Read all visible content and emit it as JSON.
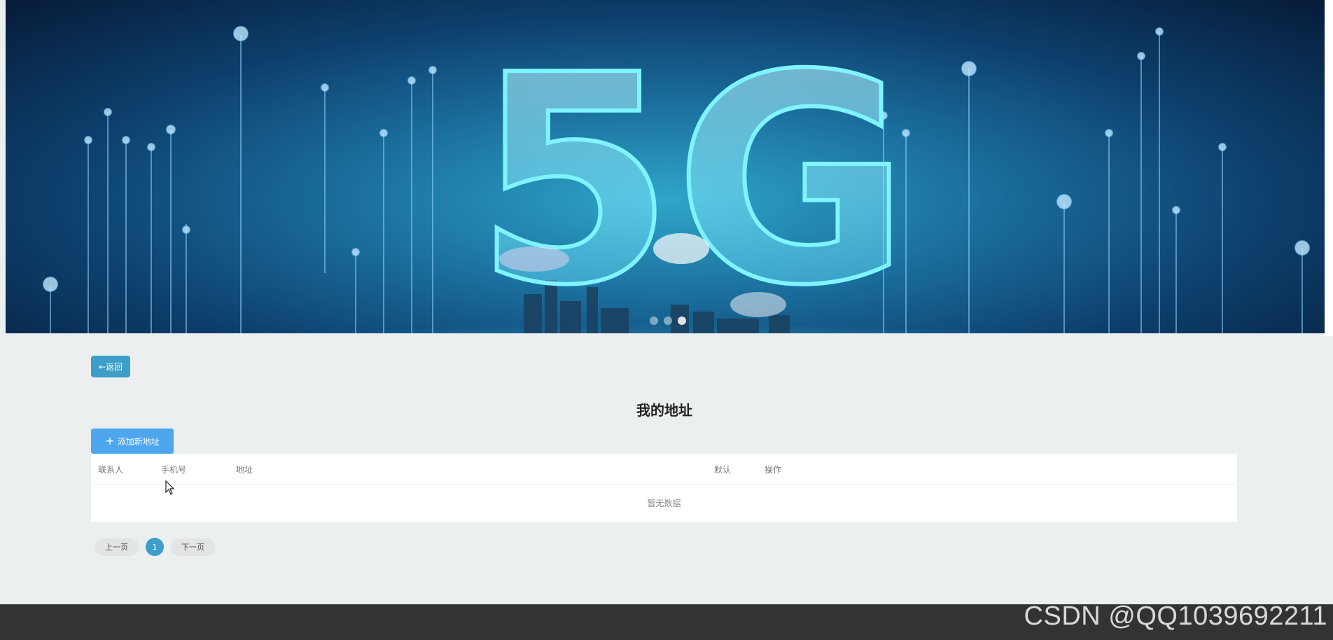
{
  "banner": {
    "headline_graphic": "5G",
    "carousel_dots": 3,
    "active_dot": 2
  },
  "back_button": {
    "label": "←返回"
  },
  "page": {
    "title": "我的地址"
  },
  "add_button": {
    "icon": "+",
    "label": "添加新地址"
  },
  "table": {
    "columns": [
      "联系人",
      "手机号",
      "地址",
      "默认",
      "操作"
    ],
    "empty_text": "暂无数据"
  },
  "pagination": {
    "prev_label": "上一页",
    "current_page": "1",
    "next_label": "下一页"
  },
  "watermark": {
    "text": "CSDN @QQ1039692211"
  },
  "colors": {
    "primary": "#3c9ec9",
    "add_button": "#4ea6ee",
    "page_bg": "#eceff0",
    "footer": "#333333"
  }
}
